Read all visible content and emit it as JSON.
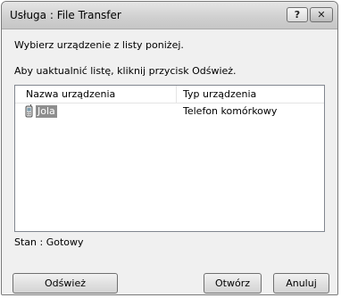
{
  "window": {
    "title": "Usługa : File Transfer",
    "help_label": "?",
    "close_label": "✕"
  },
  "instructions": {
    "line1": "Wybierz urządzenie z listy poniżej.",
    "line2": "Aby uaktualnić listę, kliknij przycisk Odśwież."
  },
  "list": {
    "columns": [
      "Nazwa urządzenia",
      "Typ urządzenia"
    ],
    "rows": [
      {
        "name": "Jola",
        "type": "Telefon komórkowy",
        "icon": "mobile-phone-icon",
        "selected": true
      }
    ]
  },
  "status": {
    "text": "Stan : Gotowy"
  },
  "buttons": {
    "refresh": "Odśwież",
    "open": "Otwórz",
    "cancel": "Anuluj"
  }
}
